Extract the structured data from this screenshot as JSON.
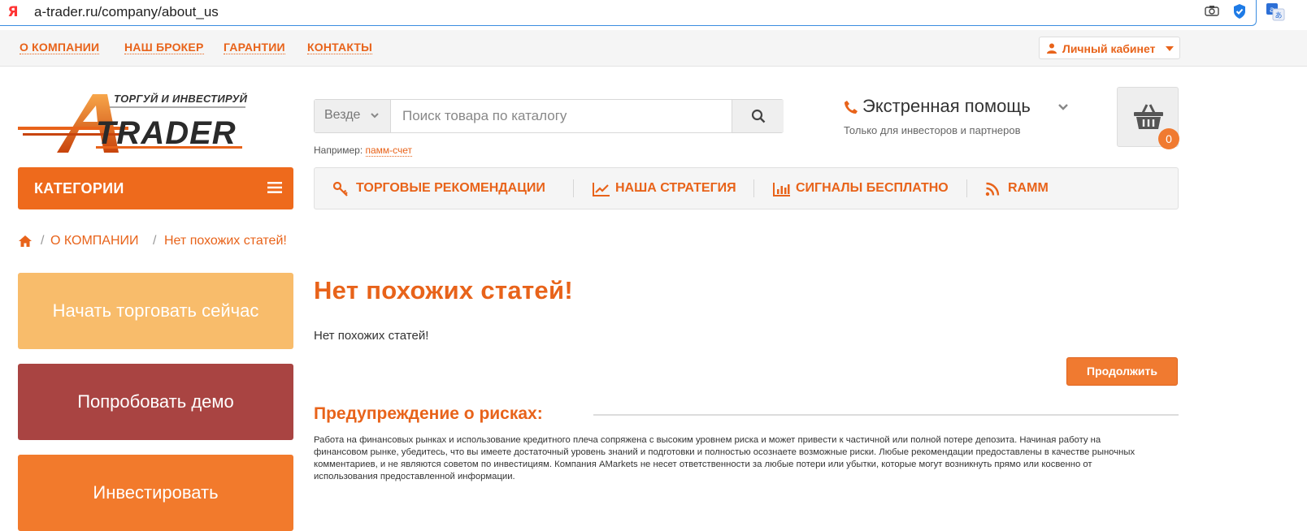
{
  "browser": {
    "url": "a-trader.ru/company/about_us",
    "logo": "Я"
  },
  "topnav": {
    "items": [
      "О КОМПАНИИ",
      "НАШ БРОКЕР",
      "ГАРАНТИИ",
      "КОНТАКТЫ"
    ],
    "account_label": "Личный кабинет"
  },
  "logo": {
    "tagline": "ТОРГУЙ И ИНВЕСТИРУЙ",
    "letter": "A",
    "name": "TRADER"
  },
  "search": {
    "scope": "Везде",
    "placeholder": "Поиск товара по каталогу",
    "example_prefix": "Например:",
    "example_link": "памм-счет"
  },
  "help": {
    "title": "Экстренная помощь",
    "subtitle": "Только для инвесторов и партнеров"
  },
  "cart": {
    "count": "0"
  },
  "categories_label": "КАТЕГОРИИ",
  "mainmenu": {
    "items": [
      "ТОРГОВЫЕ РЕКОМЕНДАЦИИ",
      "НАША СТРАТЕГИЯ",
      "СИГНАЛЫ БЕСПЛАТНО",
      "RAMM"
    ]
  },
  "breadcrumb": {
    "sep": "/",
    "items": [
      "О КОМПАНИИ",
      "Нет похожих статей!"
    ]
  },
  "sidebar": {
    "buttons": [
      "Начать торговать сейчас",
      "Попробовать демо",
      "Инвестировать"
    ]
  },
  "content": {
    "title": "Нет похожих статей!",
    "text": "Нет похожих статей!",
    "continue_label": "Продолжить",
    "warning_title": "Предупреждение о рисках:",
    "warning_text": "Работа на финансовых рынках и использование кредитного плеча сопряжена с высоким уровнем риска и может привести к частичной или полной потере депозита. Начиная работу на финансовом рынке, убедитесь, что вы имеете достаточный уровень знаний и подготовки и полностью осознаете возможные риски. Любые рекомендации предоставлены в качестве рыночных комментариев, и не являются советом по инвестициям. Компания AMarkets не несет ответственности за любые потери или убытки, которые могут возникнуть прямо или косвенно от использования предоставленной информации."
  },
  "colors": {
    "accent": "#e8631a",
    "start_button": "#f8bc6b",
    "demo_button": "#a94442",
    "invest_button": "#f27a2c"
  }
}
